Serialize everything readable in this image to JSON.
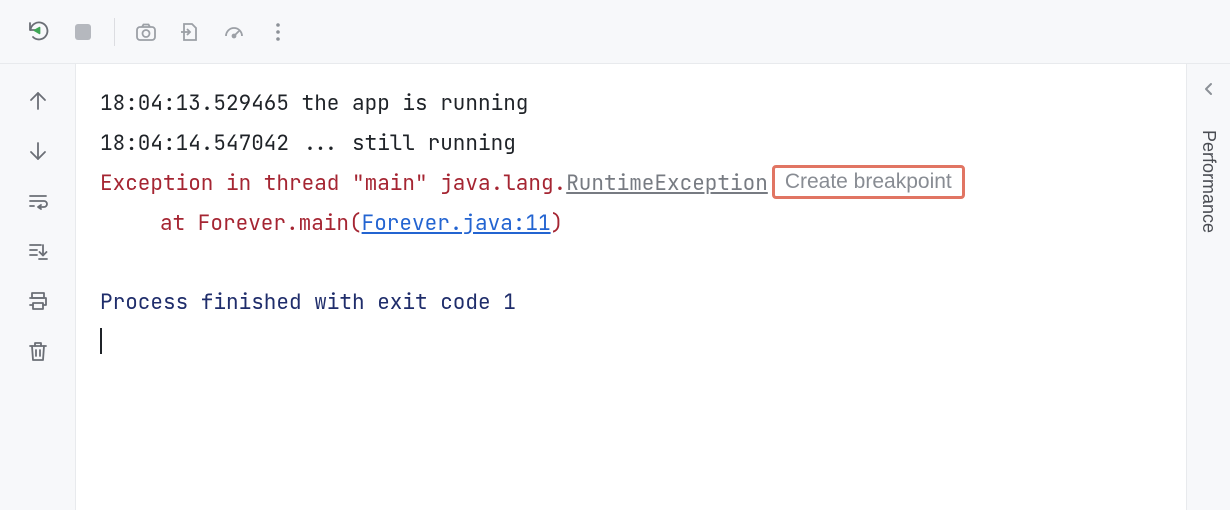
{
  "console": {
    "lines": [
      {
        "timestamp": "18:04:13.529465",
        "text": "the app is running"
      },
      {
        "timestamp": "18:04:14.547042",
        "text": "... still running"
      }
    ],
    "exception": {
      "prefix": "Exception in thread \"main\" java.lang.",
      "class_link": "RuntimeException",
      "breakpoint_hint": "Create breakpoint",
      "stack_prefix": "at Forever.main(",
      "stack_link": "Forever.java:11",
      "stack_suffix": ")"
    },
    "exit_line": "Process finished with exit code 1"
  },
  "right_panel": {
    "label": "Performance"
  }
}
